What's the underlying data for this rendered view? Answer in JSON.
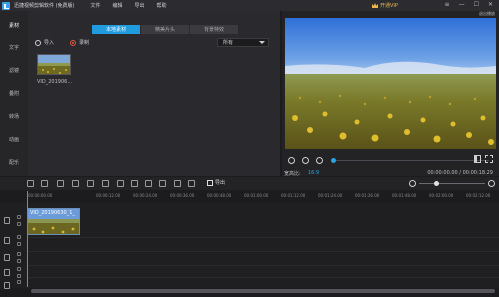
{
  "app": {
    "title": "迅捷视频剪辑软件 (免费版)",
    "menu": [
      "文件",
      "编辑",
      "导出",
      "帮助"
    ],
    "vip_label": "开通VIP",
    "window_controls": [
      "≡",
      "—",
      "☐",
      "✕"
    ]
  },
  "sidebar": {
    "items": [
      {
        "label": "素材",
        "active": true
      },
      {
        "label": "文字",
        "active": false
      },
      {
        "label": "滤镜",
        "active": false
      },
      {
        "label": "叠附",
        "active": false
      },
      {
        "label": "转场",
        "active": false
      },
      {
        "label": "动画",
        "active": false
      },
      {
        "label": "配乐",
        "active": false
      }
    ]
  },
  "media": {
    "tabs": [
      {
        "label": "本地素材",
        "active": true
      },
      {
        "label": "精美片头",
        "active": false
      },
      {
        "label": "背景特效",
        "active": false
      }
    ],
    "import_label": "导入",
    "record_label": "录制",
    "filter_value": "所有",
    "items": [
      {
        "label": "VID_201906..."
      }
    ]
  },
  "preview": {
    "top_label": "退出播放",
    "ratio_label": "宽高比:",
    "ratio_value": "16:9",
    "timecode": "00:00:00.00 / 00:00:18.29",
    "progress": 0.0
  },
  "toolbar": {
    "export_label": "导出"
  },
  "timeline": {
    "ticks": [
      "00:00:00.00",
      "00:00:12.00",
      "00:00:24.00",
      "00:00:36.00",
      "00:00:48.00",
      "00:01:00.00",
      "00:01:12.00",
      "00:01:24.00",
      "00:01:36.00",
      "00:01:48.00",
      "00:02:00.00",
      "00:02:12.00",
      "00:02:24.00",
      "00:02:36.00"
    ],
    "clip_label": "VID_20190630_1_",
    "zoom": 0.25
  },
  "colors": {
    "accent": "#1f9bde",
    "vip": "#e9b64b"
  }
}
